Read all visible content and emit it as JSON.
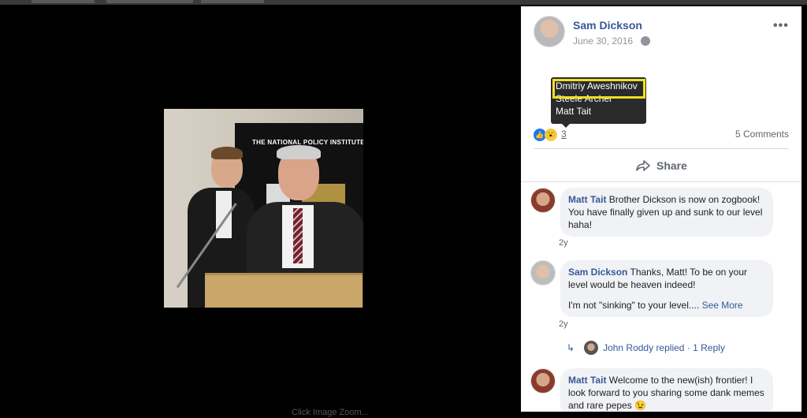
{
  "post": {
    "author": "Sam Dickson",
    "date": "June 30, 2016",
    "privacy_icon": "globe-icon",
    "more_icon": "more-dots-icon",
    "more_label": "•••"
  },
  "photo": {
    "banner_text": "THE NATIONAL POLICY INSTITUTE",
    "caption": "Click Image Zoom..."
  },
  "tooltip": {
    "names": [
      "Dmitriy Aweshnikov",
      "Steele Archer",
      "Matt Tait"
    ]
  },
  "reactions": {
    "like_icon": "👍",
    "wow_icon": "😮",
    "count": "3",
    "comments": "5 Comments"
  },
  "actions": {
    "share_label": "Share"
  },
  "comments": [
    {
      "author": "Matt Tait",
      "text": "Brother Dickson is now on zogbook! You have finally given up and sunk to our level haha!",
      "time": "2y"
    },
    {
      "author": "Sam Dickson",
      "text": "Thanks, Matt! To be on your level would be heaven indeed!",
      "text2": "I'm not \"sinking\" to your level....",
      "see_more": "See More",
      "time": "2y"
    },
    {
      "author": "Matt Tait",
      "text": "Welcome to the new(ish) frontier! I look forward to you sharing some dank memes and rare pepes 😉"
    }
  ],
  "replies": {
    "arrow": "↳",
    "text": "John Roddy replied · 1 Reply"
  },
  "colors": {
    "link": "#385898",
    "muted": "#606770",
    "highlight": "#f0e020"
  }
}
